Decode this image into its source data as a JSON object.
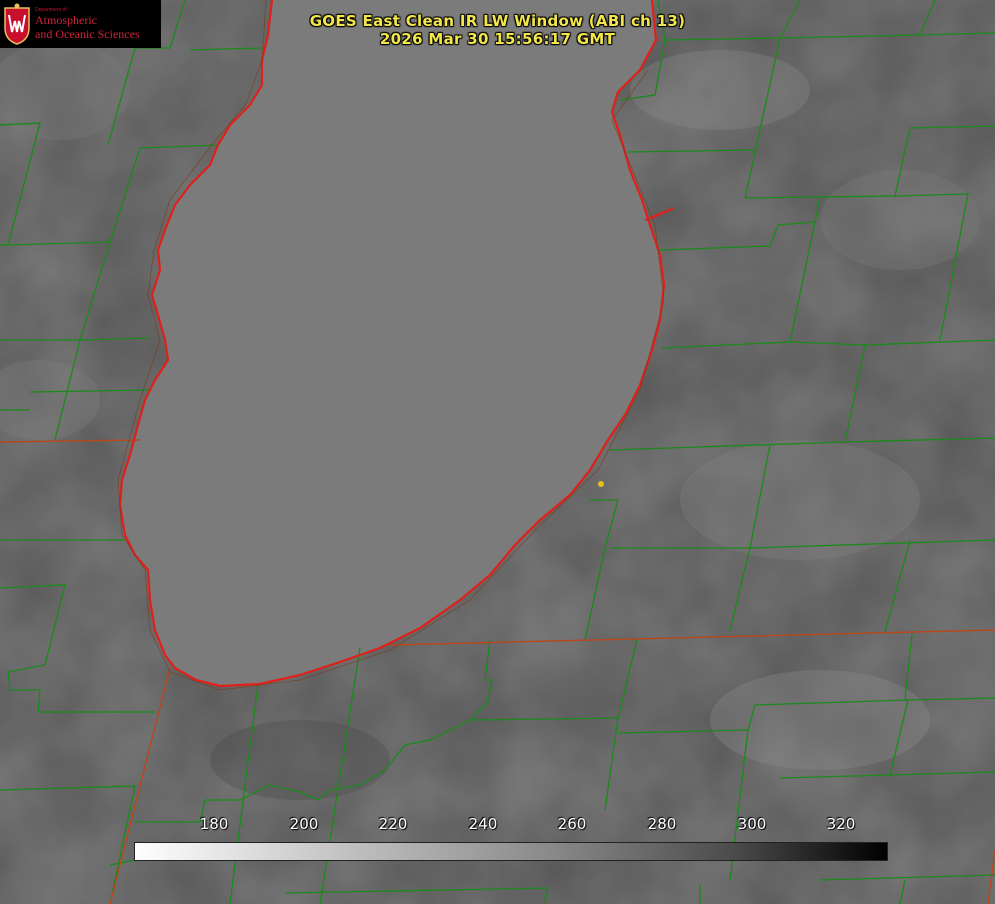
{
  "title": {
    "line1": "GOES East Clean IR LW Window (ABI ch 13)",
    "line2": "2026 Mar 30 15:56:17 GMT"
  },
  "logo": {
    "dept": "Department of",
    "line1": "Atmospheric",
    "line2": "and Oceanic Sciences",
    "crest_icon": "uw-crest-icon",
    "color": "#c8102e"
  },
  "colorbar": {
    "ticks": [
      "180",
      "200",
      "220",
      "240",
      "260",
      "280",
      "300",
      "320"
    ],
    "colors": [
      "#ffffff",
      "#000000"
    ]
  },
  "map_colors": {
    "county_lines": "#1a8a1a",
    "state_lines": "#b8471a",
    "lake_outline": "#e0201a",
    "station_marker": "#e0c020",
    "lake_fill": "#7a7a7a"
  }
}
